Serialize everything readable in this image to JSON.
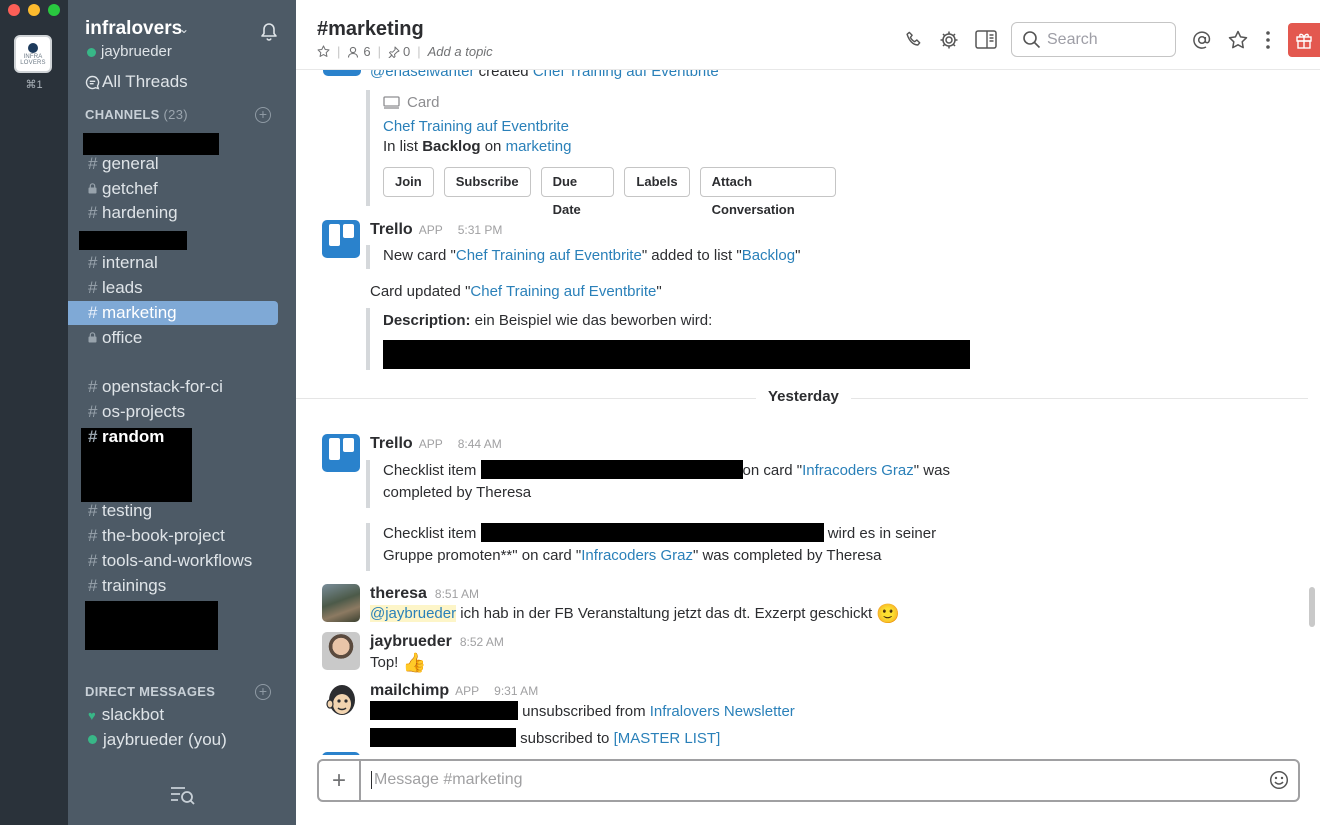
{
  "app": {
    "team_tile_text": [
      "INFRA",
      "LOVERS"
    ],
    "team_shortcut": "⌘1"
  },
  "sidebar": {
    "team_name": "infralovers",
    "user_name": "jaybrueder",
    "all_threads": "All Threads",
    "channels_header": "CHANNELS",
    "channels_count": "(23)",
    "channels": [
      {
        "prefix": "#",
        "name": "general",
        "style": "normal"
      },
      {
        "prefix": "lock",
        "name": "getchef",
        "style": "normal"
      },
      {
        "prefix": "#",
        "name": "hardening",
        "style": "normal"
      },
      {
        "prefix": "#",
        "name": "internal",
        "style": "normal"
      },
      {
        "prefix": "#",
        "name": "leads",
        "style": "normal"
      },
      {
        "prefix": "#",
        "name": "marketing",
        "style": "active"
      },
      {
        "prefix": "lock",
        "name": "office",
        "style": "normal"
      },
      {
        "prefix": "#",
        "name": "openstack-for-ci",
        "style": "normal"
      },
      {
        "prefix": "#",
        "name": "os-projects",
        "style": "normal"
      },
      {
        "prefix": "#",
        "name": "random",
        "style": "bold"
      },
      {
        "prefix": "#",
        "name": "testing",
        "style": "normal"
      },
      {
        "prefix": "#",
        "name": "the-book-project",
        "style": "normal"
      },
      {
        "prefix": "#",
        "name": "tools-and-workflows",
        "style": "normal"
      },
      {
        "prefix": "#",
        "name": "trainings",
        "style": "normal"
      }
    ],
    "dm_header": "DIRECT MESSAGES",
    "dms": [
      {
        "name": "slackbot",
        "status": "heart"
      },
      {
        "name": "jaybrueder (you)",
        "status": "online"
      }
    ]
  },
  "header": {
    "channel_name": "#marketing",
    "member_count": "6",
    "pinned_count": "0",
    "topic_placeholder": "Add a topic",
    "search_placeholder": "Search"
  },
  "messages": {
    "top_partial": {
      "mention": "@ehaselwanter",
      "verb": " created ",
      "link": "Chef Training auf Eventbrite"
    },
    "card": {
      "label": "Card",
      "title": "Chef Training auf Eventbrite",
      "in_list_prefix": "In list ",
      "list_name": "Backlog",
      "on_word": " on ",
      "board_name": "marketing",
      "buttons": [
        "Join",
        "Subscribe",
        "Due Date",
        "Labels",
        "Attach Conversation"
      ]
    },
    "trello1": {
      "name": "Trello",
      "badge": "APP",
      "time": "5:31 PM",
      "line1_a": "New card \"",
      "line1_link": "Chef Training auf Eventbrite",
      "line1_b": "\" added to list \"",
      "line1_list": "Backlog",
      "line1_c": "\"",
      "line2_a": "Card updated \"",
      "line2_link": "Chef Training auf Eventbrite",
      "line2_b": "\"",
      "desc_label": "Description:",
      "desc_text": " ein Beispiel wie das beworben wird:"
    },
    "day_divider": "Yesterday",
    "trello2": {
      "name": "Trello",
      "badge": "APP",
      "time": "8:44 AM",
      "c1_a": "Checklist item ",
      "c1_b": "on card \"",
      "c1_link": "Infracoders Graz",
      "c1_c": "\" was",
      "c1_d": "completed by Theresa",
      "c2_a": "Checklist item ",
      "c2_b": " wird es in seiner",
      "c2_c": "Gruppe promoten**\" on card \"",
      "c2_link": "Infracoders Graz",
      "c2_d": "\" was completed by Theresa"
    },
    "theresa": {
      "name": "theresa",
      "time": "8:51 AM",
      "mention": "@jaybrueder",
      "text": " ich hab in der FB Veranstaltung jetzt das dt. Exzerpt geschickt",
      "emoji": "🙂"
    },
    "jay": {
      "name": "jaybrueder",
      "time": "8:52 AM",
      "text": "Top!",
      "emoji": "👍"
    },
    "mailchimp": {
      "name": "mailchimp",
      "badge": "APP",
      "time": "9:31 AM",
      "line1_text": "unsubscribed from ",
      "line1_link": "Infralovers Newsletter",
      "line2_text": "subscribed to ",
      "line2_link": "[MASTER LIST]"
    }
  },
  "composer": {
    "placeholder": "Message #marketing"
  },
  "colors": {
    "sidebar_bg": "#4d5a66",
    "rail_bg": "#2a323a",
    "active_channel": "#7fa9d6",
    "link": "#2a80b9",
    "online": "#38b787",
    "gift": "#e3584f"
  }
}
